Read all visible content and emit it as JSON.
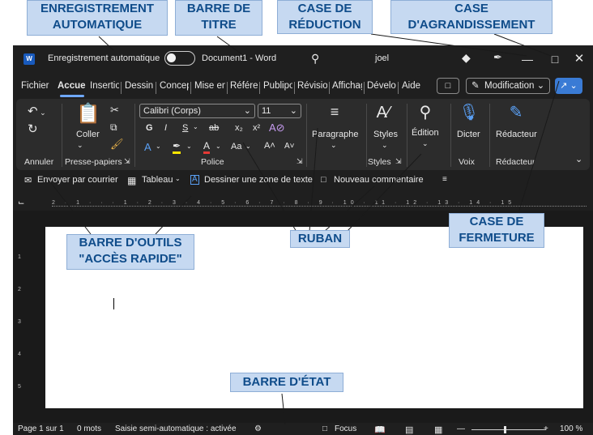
{
  "callouts": {
    "autosave": [
      "ENREGISTREMENT",
      "AUTOMATIQUE"
    ],
    "title_bar": [
      "BARRE DE",
      "TITRE"
    ],
    "minimize": [
      "CASE DE",
      "RÉDUCTION"
    ],
    "maximize": [
      "CASE",
      "D'AGRANDISSEMENT"
    ],
    "close": [
      "CASE DE",
      "FERMETURE"
    ],
    "qat": [
      "BARRE D'OUTILS",
      "\"ACCÈS RAPIDE\""
    ],
    "ribbon": "RUBAN",
    "status_bar": "BARRE D'ÉTAT"
  },
  "title_bar": {
    "app_icon": "W",
    "autosave_label": "Enregistrement automatique",
    "doc_title": "Document1  -  Word",
    "user": "joel"
  },
  "tabs": [
    "Fichier",
    "Accueil",
    "Insertion",
    "Dessin",
    "Conception",
    "Mise en page",
    "Références",
    "Publipostage",
    "Révision",
    "Affichage",
    "Développeur",
    "Aide"
  ],
  "tab_right": {
    "mode_label": "Modification"
  },
  "ribbon": {
    "undo": {
      "label": "Annuler"
    },
    "clipboard": {
      "paste_label": "Coller",
      "label": "Presse-papiers"
    },
    "font": {
      "name": "Calibri (Corps)",
      "size": "11",
      "label": "Police",
      "bold": "G",
      "italic": "I",
      "underline": "S",
      "strike": "ab",
      "sub": "x₂",
      "sup": "x²",
      "case": "Aa",
      "grow": "A˄",
      "shrink": "A˅"
    },
    "paragraph": {
      "label": "Paragraphe"
    },
    "styles": {
      "button": "Styles",
      "label": "Styles"
    },
    "editing": {
      "button": "Édition"
    },
    "voice": {
      "button": "Dicter",
      "label": "Voix"
    },
    "editor": {
      "button": "Rédacteur",
      "label": "Rédacteur"
    }
  },
  "qat": {
    "email": "Envoyer par courrier",
    "table": "Tableau",
    "textbox": "Dessiner une zone de texte",
    "comment": "Nouveau commentaire"
  },
  "rulers": {
    "horizontal": "2 · 1 · · · 1 · 2 · 3 · 4 · 5 · 6 · 7 · 8 · 9 · 10 · 11 · 12 · 13 · 14 · 15 ·",
    "vertical": [
      "1",
      "2",
      "3",
      "4",
      "5"
    ]
  },
  "status_bar": {
    "page": "Page 1 sur 1",
    "words": "0 mots",
    "autocorrect": "Saisie semi-automatique : activée",
    "focus": "Focus",
    "zoom": "100 %"
  }
}
